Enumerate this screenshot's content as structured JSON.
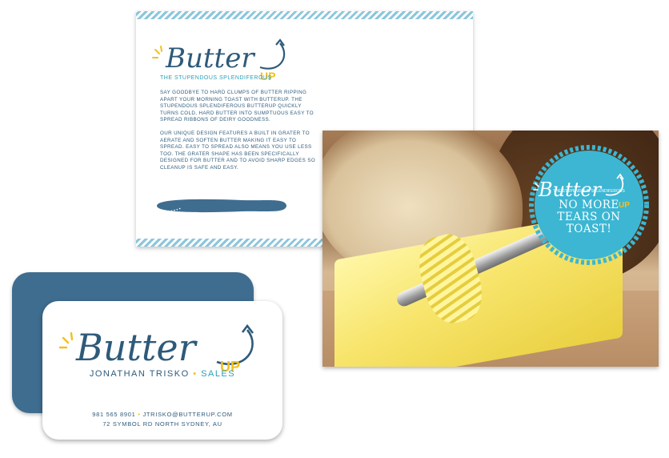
{
  "logo": {
    "word": "Butter",
    "up": "UP",
    "tagline": "THE STUPENDOUS SPLENDIFEROUS"
  },
  "flyer": {
    "paragraphs": [
      "SAY GOODBYE TO HARD CLUMPS OF BUTTER RIPPING APART YOUR MORNING TOAST WITH BUTTERUP. THE STUPENDOUS SPLENDIFEROUS BUTTERUP QUICKLY TURNS COLD, HARD BUTTER INTO SUMPTUOUS EASY TO SPREAD RIBBONS OF DEIRY GOODNESS.",
      "OUR UNIQUE DESIGN FEATURES A BUILT IN GRATER TO AERATE AND SOFTEN BUTTER MAKING IT EASY TO SPREAD. EASY TO SPREAD ALSO MEANS YOU USE LESS TOO. THE GRATER SHAPE HAS BEEN SPECIFICALLY DESIGNED FOR BUTTER AND TO AVOID SHARP EDGES SO CLEANUP IS SAFE AND EASY."
    ]
  },
  "badge": {
    "line1": "NO MORE",
    "line2": "TEARS ON",
    "line3": "TOAST!"
  },
  "card": {
    "name": "JONATHAN TRISKO",
    "separator": "•",
    "role": "SALES",
    "phone": "981 565 8901",
    "email": "JTRISKO@BUTTERUP.COM",
    "address": "72 SYMBOL RD NORTH SYDNEY, AU"
  },
  "colors": {
    "navy": "#2e5a7a",
    "teal": "#2aa0b8",
    "yellow": "#f2c01e",
    "card_back": "#3f6d8f",
    "badge": "#3cb6d3"
  }
}
